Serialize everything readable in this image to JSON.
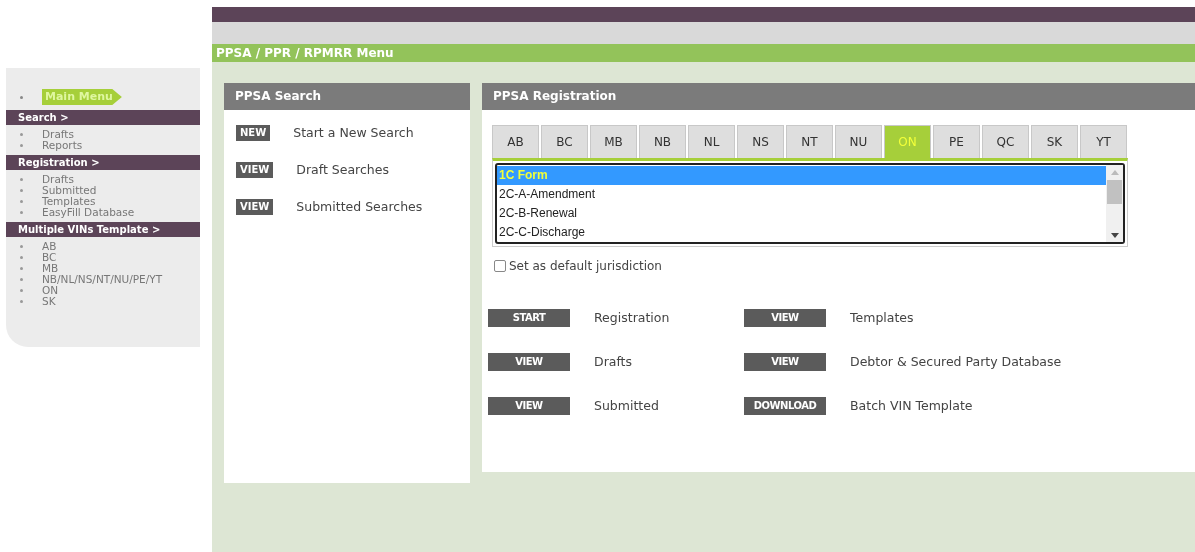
{
  "header": {
    "title": "PPSA / PPR / RPMRR Menu"
  },
  "sidebar": {
    "main_menu": {
      "label": "Main Menu",
      "selected": true
    },
    "sections": [
      {
        "title": "Search >",
        "items": [
          "Drafts",
          "Reports"
        ]
      },
      {
        "title": "Registration >",
        "items": [
          "Drafts",
          "Submitted",
          "Templates",
          "EasyFill Database"
        ]
      },
      {
        "title": "Multiple VINs Template >",
        "items": [
          "AB",
          "BC",
          "MB",
          "NB/NL/NS/NT/NU/PE/YT",
          "ON",
          "SK"
        ]
      }
    ]
  },
  "search_panel": {
    "title": "PPSA Search",
    "actions": [
      {
        "button": "NEW",
        "label": "Start a New Search"
      },
      {
        "button": "VIEW",
        "label": "Draft Searches"
      },
      {
        "button": "VIEW",
        "label": "Submitted Searches"
      }
    ]
  },
  "registration_panel": {
    "title": "PPSA Registration",
    "tabs": [
      {
        "label": "AB",
        "selected": false
      },
      {
        "label": "BC",
        "selected": false
      },
      {
        "label": "MB",
        "selected": false
      },
      {
        "label": "NB",
        "selected": false
      },
      {
        "label": "NL",
        "selected": false
      },
      {
        "label": "NS",
        "selected": false
      },
      {
        "label": "NT",
        "selected": false
      },
      {
        "label": "NU",
        "selected": false
      },
      {
        "label": "ON",
        "selected": true
      },
      {
        "label": "PE",
        "selected": false
      },
      {
        "label": "QC",
        "selected": false
      },
      {
        "label": "SK",
        "selected": false
      },
      {
        "label": "YT",
        "selected": false
      }
    ],
    "forms": [
      {
        "label": "1C Form",
        "selected": true
      },
      {
        "label": "2C-A-Amendment",
        "selected": false
      },
      {
        "label": "2C-B-Renewal",
        "selected": false
      },
      {
        "label": "2C-C-Discharge",
        "selected": false
      }
    ],
    "default_jurisdiction": {
      "label": "Set as default jurisdiction",
      "checked": false
    },
    "actions": [
      {
        "button": "START",
        "label": "Registration"
      },
      {
        "button": "VIEW",
        "label": "Templates"
      },
      {
        "button": "VIEW",
        "label": "Drafts"
      },
      {
        "button": "VIEW",
        "label": "Debtor & Secured Party Database"
      },
      {
        "button": "VIEW",
        "label": "Submitted"
      },
      {
        "button": "DOWNLOAD",
        "label": "Batch VIN Template"
      }
    ]
  }
}
